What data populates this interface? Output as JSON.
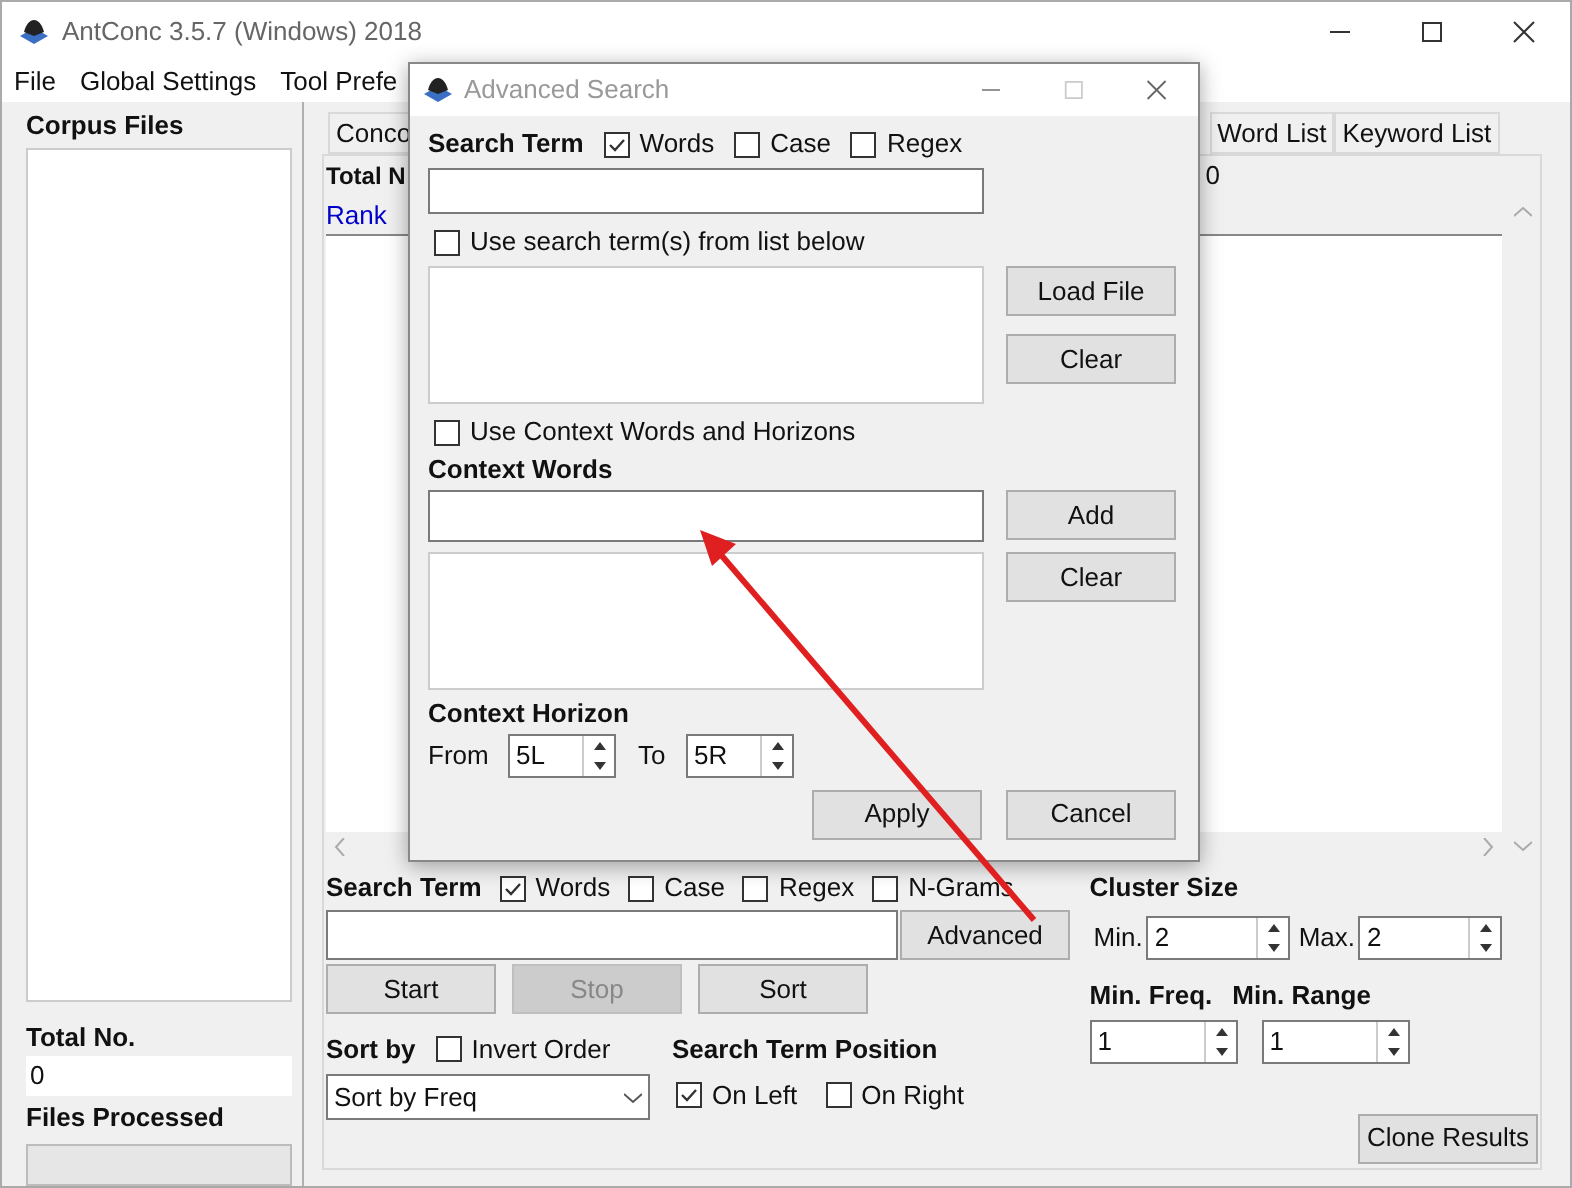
{
  "window": {
    "title": "AntConc 3.5.7 (Windows) 2018"
  },
  "menu": [
    "File",
    "Global Settings",
    "Tool Prefe"
  ],
  "corpus_panel": {
    "title": "Corpus Files",
    "total_label": "Total No.",
    "total_value": "0",
    "files_processed_label": "Files Processed",
    "progress": {
      "level": 0
    }
  },
  "tabs": [
    {
      "label": "Conco",
      "selected": false
    },
    {
      "label": "Word List",
      "selected": false
    },
    {
      "label": "Keyword List",
      "selected": false
    }
  ],
  "results": {
    "total_label": "Total N",
    "total_value": "0",
    "column_1": "Rank"
  },
  "search": {
    "label": "Search Term",
    "options": [
      {
        "label": "Words",
        "checked": true
      },
      {
        "label": "Case",
        "checked": false
      },
      {
        "label": "Regex",
        "checked": false
      },
      {
        "label": "N-Grams",
        "checked": false
      }
    ],
    "advanced_button": "Advanced"
  },
  "actions": [
    {
      "label": "Start",
      "disabled": false
    },
    {
      "label": "Stop",
      "disabled": true
    },
    {
      "label": "Sort",
      "disabled": false
    }
  ],
  "sort": {
    "label": "Sort by",
    "invert": {
      "label": "Invert Order",
      "checked": false
    },
    "value": "Sort by Freq"
  },
  "position": {
    "label": "Search Term Position",
    "options": [
      {
        "label": "On Left",
        "checked": true
      },
      {
        "label": "On Right",
        "checked": false
      }
    ]
  },
  "cluster": {
    "label": "Cluster Size",
    "min_label": "Min.",
    "min_value": "2",
    "max_label": "Max.",
    "max_value": "2"
  },
  "frequency": {
    "min_freq_label": "Min. Freq.",
    "min_range_label": "Min. Range",
    "min_freq": "1",
    "min_range": "1"
  },
  "clone_button": "Clone Results",
  "dialog": {
    "title": "Advanced Search",
    "search_label": "Search Term",
    "options": [
      {
        "label": "Words",
        "checked": true
      },
      {
        "label": "Case",
        "checked": false
      },
      {
        "label": "Regex",
        "checked": false
      }
    ],
    "use_list": {
      "label": "Use search term(s) from list below",
      "checked": false
    },
    "load_button": "Load File",
    "clear_button": "Clear",
    "use_context": {
      "label": "Use Context Words and Horizons",
      "checked": false
    },
    "context_label": "Context Words",
    "add_button": "Add",
    "context_clear_button": "Clear",
    "horizon_label": "Context Horizon",
    "from_label": "From",
    "from_value": "5L",
    "to_label": "To",
    "to_value": "5R",
    "buttons": [
      "Apply",
      "Cancel"
    ]
  }
}
